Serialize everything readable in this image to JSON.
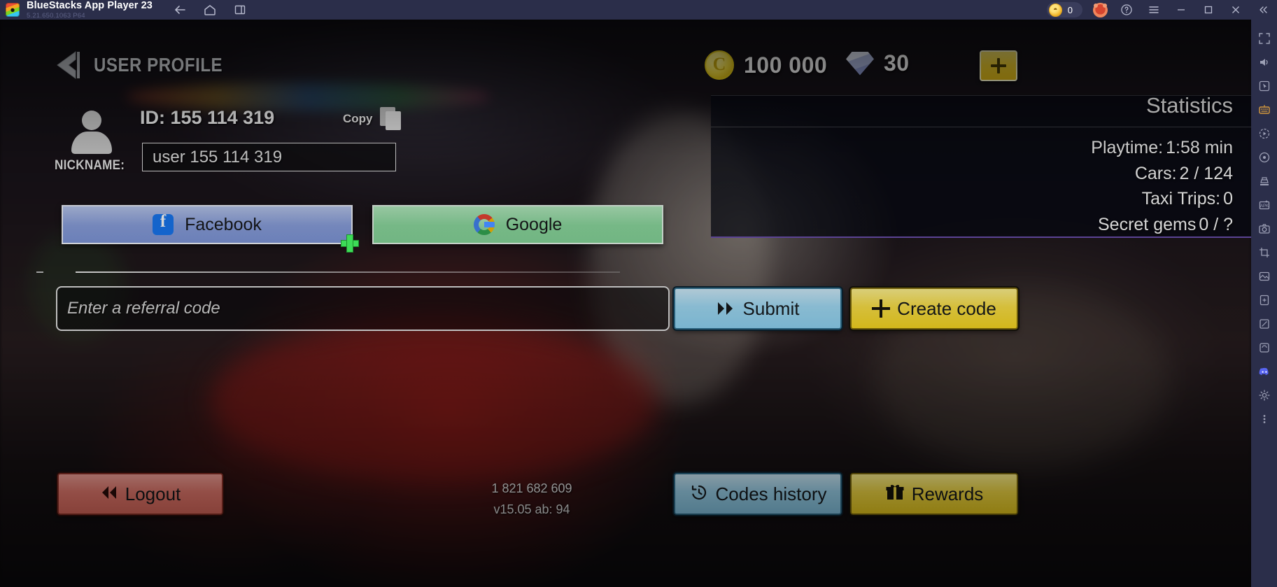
{
  "titlebar": {
    "app_name": "BlueStacks App Player 23",
    "app_version": "5.21.650.1063  P64",
    "nav": [
      {
        "name": "back-icon",
        "label": "Back"
      },
      {
        "name": "home-icon",
        "label": "Home"
      },
      {
        "name": "multi-instance-icon",
        "label": "Multi-instance"
      }
    ],
    "coin_count": "0",
    "icons": [
      "points-coin-icon",
      "mascot-icon",
      "help-icon",
      "menu-icon",
      "minimize-icon",
      "maximize-icon",
      "close-icon",
      "collapse-icon"
    ]
  },
  "sidebar": {
    "items": [
      {
        "name": "fullscreen-icon"
      },
      {
        "name": "volume-icon"
      },
      {
        "name": "screenshot-icon"
      },
      {
        "name": "keymapping-icon"
      },
      {
        "name": "record-icon"
      },
      {
        "name": "macro-icon"
      },
      {
        "name": "shake-icon"
      },
      {
        "name": "install-apk-icon"
      },
      {
        "name": "location-icon"
      },
      {
        "name": "rotate-icon"
      },
      {
        "name": "media-manager-icon"
      },
      {
        "name": "eco-mode-icon"
      },
      {
        "name": "multi-instance-manager-icon"
      },
      {
        "name": "trim-icon"
      },
      {
        "name": "discord-icon"
      },
      {
        "name": "settings-icon"
      },
      {
        "name": "more-icon"
      }
    ]
  },
  "game": {
    "header": {
      "back_label": "back-arrow",
      "title": "USER PROFILE",
      "coins": "100 000",
      "gems": "30",
      "add_label": "+"
    },
    "statistics": {
      "title": "Statistics",
      "rows": [
        {
          "label": "Playtime:",
          "value": "1:58 min"
        },
        {
          "label": "Cars:",
          "value": "2 / 124"
        },
        {
          "label": "Taxi Trips:",
          "value": "0"
        },
        {
          "label": "Secret gems",
          "value": "0 / ?"
        }
      ]
    },
    "profile": {
      "id_line": "ID: 155 114 319",
      "copy_label": "Copy",
      "nickname_label": "NICKNAME:",
      "nickname_value": "user 155 114 319"
    },
    "social": {
      "facebook_label": "Facebook",
      "google_label": "Google"
    },
    "referral": {
      "placeholder": "Enter a referral code",
      "submit_label": "Submit",
      "create_label": "Create code"
    },
    "footer": {
      "logout_label": "Logout",
      "codes_history_label": "Codes history",
      "rewards_label": "Rewards",
      "build_number": "1 821 682 609",
      "version": "v15.05 ab: 94"
    },
    "colors": {
      "yellow": "#f3d31f",
      "blue": "#9ed8f2",
      "red": "#ea7c70",
      "facebook": "#8ba1df",
      "google": "#8ddba0",
      "panel_accent": "#6c4fb0"
    }
  }
}
